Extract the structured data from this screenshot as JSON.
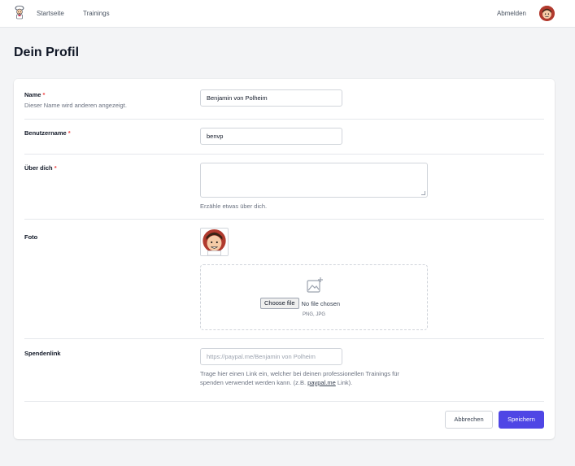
{
  "nav": {
    "home": "Startseite",
    "trainings": "Trainings",
    "logout": "Abmelden",
    "logo_icon": "chef-mascot-icon",
    "avatar_icon": "user-avatar-icon"
  },
  "page": {
    "title": "Dein Profil"
  },
  "form": {
    "name": {
      "label": "Name",
      "required_mark": "*",
      "description": "Dieser Name wird anderen angezeigt.",
      "value": "Benjamin von Polheim"
    },
    "username": {
      "label": "Benutzername",
      "required_mark": "*",
      "value": "benvp"
    },
    "about": {
      "label": "Über dich",
      "required_mark": "*",
      "value": "",
      "help": "Erzähle etwas über dich."
    },
    "photo": {
      "label": "Foto",
      "upload_icon": "image-add-icon",
      "choose_file_label": "Choose file",
      "no_file_text": "No file chosen",
      "file_types": "PNG, JPG"
    },
    "donation": {
      "label": "Spendenlink",
      "value": "",
      "placeholder": "https://paypal.me/Benjamin von Polheim",
      "help_part1": "Trage hier einen Link ein, welcher bei deinen professionellen Trainings für",
      "help_part2": "spenden verwendet werden kann. (z.B.",
      "help_link": "paypal.me",
      "help_part3": "Link)."
    }
  },
  "actions": {
    "cancel": "Abbrechen",
    "save": "Speichern"
  },
  "colors": {
    "primary": "#4f46e5",
    "required": "#ef4444",
    "avatar_bg": "#c0392b"
  }
}
